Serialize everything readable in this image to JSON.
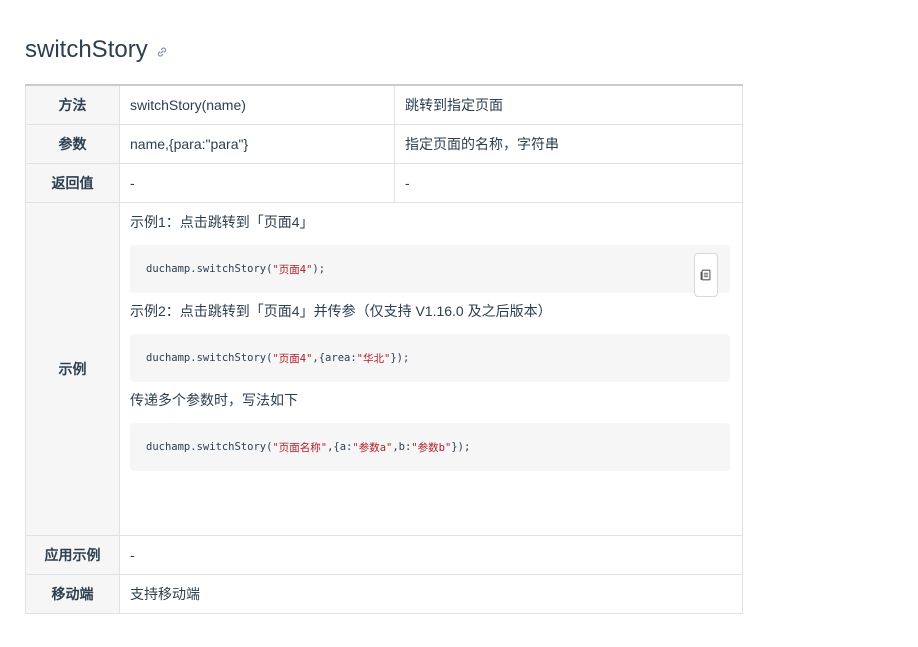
{
  "page": {
    "title": "switchStory"
  },
  "icons": {
    "anchor": "link-icon",
    "copy": "copy-icon"
  },
  "colors": {
    "string_literal": "#b31d28",
    "header_bg": "#f6f6f7",
    "text": "#2c3e50"
  },
  "table": {
    "rows": [
      {
        "key": "方法",
        "value": "switchStory(name)",
        "desc": "跳转到指定页面"
      },
      {
        "key": "参数",
        "value": "name,{para:\"para\"}",
        "desc": "指定页面的名称，字符串"
      },
      {
        "key": "返回值",
        "value": "-",
        "desc": "-"
      }
    ],
    "example": {
      "key": "示例",
      "ex1_text": "示例1：点击跳转到「页面4」",
      "ex1_code_pre": "duchamp.switchStory(",
      "ex1_code_str": "\"页面4\"",
      "ex1_code_post": ");",
      "ex2_text": "示例2：点击跳转到「页面4」并传参（仅支持 V1.16.0 及之后版本）",
      "ex2_code_pre": "duchamp.switchStory(",
      "ex2_code_str1": "\"页面4\"",
      "ex2_code_mid": ",{area:",
      "ex2_code_str2": "\"华北\"",
      "ex2_code_post": "});",
      "ex3_text": "传递多个参数时，写法如下",
      "ex3_code_pre": "duchamp.switchStory(",
      "ex3_code_str1": "\"页面名称\"",
      "ex3_code_mid1": ",{a:",
      "ex3_code_str2": "\"参数a\"",
      "ex3_code_mid2": ",b:",
      "ex3_code_str3": "\"参数b\"",
      "ex3_code_post": "});"
    },
    "usage": {
      "key": "应用示例",
      "value": "-"
    },
    "mobile": {
      "key": "移动端",
      "value": "支持移动端"
    }
  }
}
